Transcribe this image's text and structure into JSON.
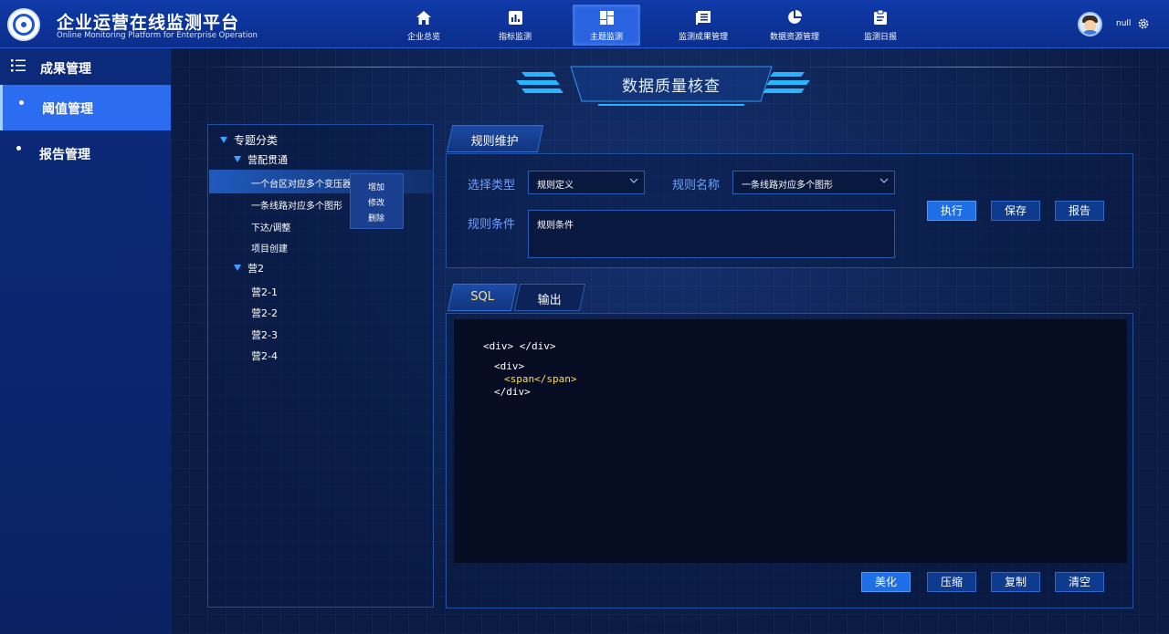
{
  "header": {
    "title": "企业运营在线监测平台",
    "subtitle": "Online Monitoring Platform for Enterprise Operation",
    "username": "null",
    "nav": [
      {
        "label": "企业总览",
        "icon": "home-icon",
        "active": false
      },
      {
        "label": "指标监测",
        "icon": "bar-chart-icon",
        "active": false
      },
      {
        "label": "主题监测",
        "icon": "dashboard-grid-icon",
        "active": true
      },
      {
        "label": "监测成果管理",
        "icon": "document-list-icon",
        "active": false
      },
      {
        "label": "数据资源管理",
        "icon": "pie-chart-icon",
        "active": false
      },
      {
        "label": "监测日报",
        "icon": "clipboard-icon",
        "active": false
      }
    ]
  },
  "sidebar": {
    "heading": "成果管理",
    "items": [
      {
        "label": "阈值管理",
        "active": true
      },
      {
        "label": "报告管理",
        "active": false
      }
    ]
  },
  "page": {
    "title": "数据质量核查"
  },
  "tree": {
    "root": "专题分类",
    "group1": {
      "label": "营配贯通",
      "children": [
        "一个台区对应多个变压器",
        "一条线路对应多个图形",
        "下达/调整",
        "项目创建"
      ]
    },
    "group2": {
      "label": "营2",
      "children": [
        "营2-1",
        "营2-2",
        "营2-3",
        "营2-4"
      ]
    },
    "context_menu": [
      "增加",
      "修改",
      "删除"
    ]
  },
  "rule": {
    "tab": "规则维护",
    "type_label": "选择类型",
    "type_value": "规则定义",
    "name_label": "规则名称",
    "name_value": "一条线路对应多个图形",
    "condition_label": "规则条件",
    "condition_value": "规则条件",
    "buttons": {
      "execute": "执行",
      "save": "保存",
      "report": "报告"
    }
  },
  "code": {
    "tabs": [
      "SQL",
      "输出"
    ],
    "lines": [
      "<div> </div>",
      "<div>",
      "<span</span>",
      "</div>"
    ],
    "buttons": {
      "beautify": "美化",
      "compress": "压缩",
      "copy": "复制",
      "clear": "清空"
    }
  },
  "colors": {
    "header_bg": "#0b2e8c",
    "sidebar_active": "#2b6cf0",
    "label_blue": "#6fa0ff",
    "code_highlight": "#ffdc5a"
  }
}
